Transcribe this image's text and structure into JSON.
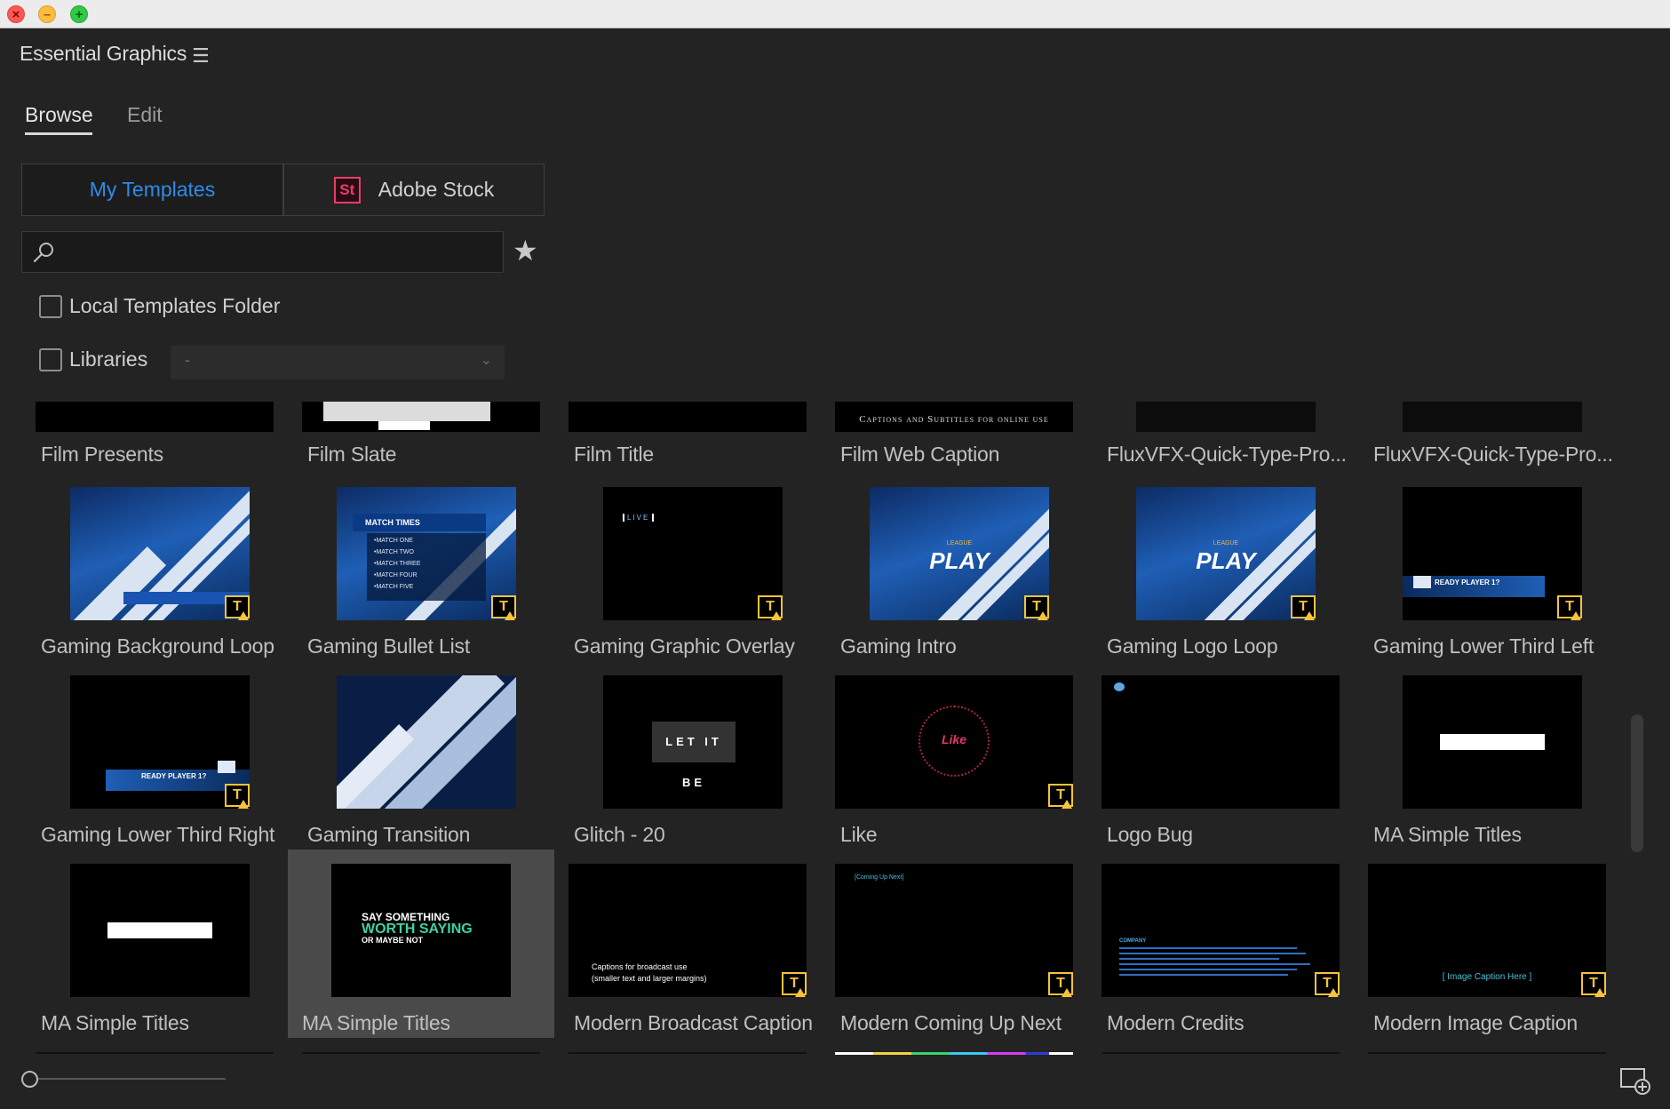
{
  "panel": {
    "title": "Essential Graphics",
    "menu_glyph": "☰",
    "tabs": [
      "Browse",
      "Edit"
    ]
  },
  "source_tabs": {
    "my_templates": "My Templates",
    "adobe_stock": "Adobe Stock",
    "stock_icon_text": "St"
  },
  "search": {
    "placeholder": "",
    "value": ""
  },
  "filters": {
    "local_templates": "Local Templates Folder",
    "libraries": "Libraries",
    "libraries_value": "-"
  },
  "templates": [
    {
      "label": "Film Presents"
    },
    {
      "label": "Film Slate"
    },
    {
      "label": "Film Title"
    },
    {
      "label": "Film Web Caption",
      "thumb_text": "Captions and Subtitles for online use"
    },
    {
      "label": "FluxVFX-Quick-Type-Pro..."
    },
    {
      "label": "FluxVFX-Quick-Type-Pro..."
    },
    {
      "label": "Gaming Background Loop",
      "badge": true
    },
    {
      "label": "Gaming Bullet List",
      "badge": true,
      "thumb_text": "MATCH TIMES",
      "bullets": [
        "•MATCH ONE",
        "•MATCH TWO",
        "•MATCH THREE",
        "•MATCH FOUR",
        "•MATCH FIVE"
      ]
    },
    {
      "label": "Gaming Graphic Overlay",
      "badge": true,
      "thumb_text": "LIVE"
    },
    {
      "label": "Gaming Intro",
      "badge": true,
      "thumb_small": "LEAGUE",
      "thumb_text": "PLAY"
    },
    {
      "label": "Gaming Logo Loop",
      "badge": true,
      "thumb_small": "LEAGUE",
      "thumb_text": "PLAY"
    },
    {
      "label": "Gaming Lower Third Left",
      "badge": true,
      "thumb_text": "READY PLAYER 1?"
    },
    {
      "label": "Gaming Lower Third Right",
      "badge": true,
      "thumb_text": "READY PLAYER 1?"
    },
    {
      "label": "Gaming Transition"
    },
    {
      "label": "Glitch - 20",
      "thumb_text": "LET IT BE"
    },
    {
      "label": "Like",
      "badge": true,
      "thumb_text": "Like"
    },
    {
      "label": "Logo Bug"
    },
    {
      "label": "MA Simple Titles"
    },
    {
      "label": "MA Simple Titles"
    },
    {
      "label": "MA Simple Titles",
      "selected": true,
      "thumb_lines": [
        "SAY SOMETHING",
        "WORTH SAYING",
        "OR MAYBE NOT"
      ]
    },
    {
      "label": "Modern Broadcast Caption",
      "badge": true,
      "thumb_lines": [
        "Captions for broadcast use",
        "(smaller text and larger margins)"
      ]
    },
    {
      "label": "Modern Coming Up Next",
      "badge": true,
      "thumb_text": "[Coming Up Next]"
    },
    {
      "label": "Modern Credits",
      "badge": true,
      "thumb_text": "COMPANY"
    },
    {
      "label": "Modern Image Caption",
      "badge": true,
      "thumb_text": "[ Image Caption Here ]"
    }
  ],
  "badge_glyph": "T",
  "icons": {
    "search": "search-icon",
    "star": "star-icon",
    "new_item": "new-item-icon"
  },
  "colors": {
    "accent": "#2d8ceb",
    "badge": "#f6c33a",
    "stock": "#ea3e67"
  }
}
